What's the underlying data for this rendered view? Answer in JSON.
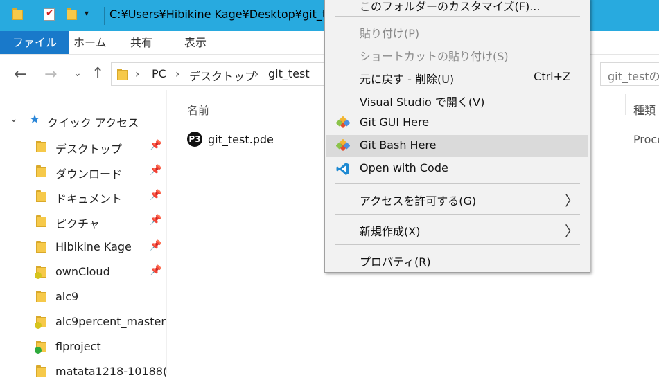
{
  "titlebar": {
    "path": "C:¥Users¥Hibikine Kage¥Desktop¥git_t",
    "dropdown": "▾"
  },
  "ribbon": {
    "tabs": [
      "ファイル",
      "ホーム",
      "共有",
      "表示"
    ]
  },
  "address": {
    "crumbs": [
      "PC",
      "デスクトップ",
      "git_test"
    ],
    "separator": "›",
    "search_placeholder": "git_testの"
  },
  "nav": {
    "back": "←",
    "forward": "→",
    "recent": "⌄",
    "up": "↑"
  },
  "sidebar": {
    "quick_access": "クイック アクセス",
    "items": [
      {
        "label": "デスクトップ",
        "pinned": true
      },
      {
        "label": "ダウンロード",
        "pinned": true
      },
      {
        "label": "ドキュメント",
        "pinned": true
      },
      {
        "label": "ピクチャ",
        "pinned": true
      },
      {
        "label": "Hibikine Kage",
        "pinned": true
      },
      {
        "label": "ownCloud",
        "pinned": true
      },
      {
        "label": "alc9",
        "pinned": false
      },
      {
        "label": "alc9percent_master",
        "pinned": false
      },
      {
        "label": "flproject",
        "pinned": false
      },
      {
        "label": "matata1218-10188(",
        "pinned": false
      }
    ],
    "pin_glyph": "📌"
  },
  "filelist": {
    "col_name": "名前",
    "col_type": "種類",
    "files": [
      {
        "name": "git_test.pde",
        "type": "Proce",
        "icon": "processing-icon"
      }
    ]
  },
  "context_menu": {
    "items": [
      {
        "label": "このフォルダーのカスタマイズ(F)...",
        "enabled": true
      },
      {
        "label": "貼り付け(P)",
        "enabled": false
      },
      {
        "label": "ショートカットの貼り付け(S)",
        "enabled": false
      },
      {
        "label": "元に戻す - 削除(U)",
        "shortcut": "Ctrl+Z",
        "enabled": true
      },
      {
        "label": "Visual Studio で開く(V)",
        "enabled": true
      },
      {
        "label": "Git GUI Here",
        "enabled": true,
        "icon": "git-icon"
      },
      {
        "label": "Git Bash Here",
        "enabled": true,
        "icon": "git-icon",
        "highlighted": true
      },
      {
        "label": "Open with Code",
        "enabled": true,
        "icon": "vscode-icon"
      },
      {
        "label": "アクセスを許可する(G)",
        "enabled": true,
        "submenu": true
      },
      {
        "label": "新規作成(X)",
        "enabled": true,
        "submenu": true
      },
      {
        "label": "プロパティ(R)",
        "enabled": true
      }
    ],
    "submenu_glyph": "〉"
  },
  "colors": {
    "titlebar": "#28aadf",
    "file_tab": "#1979ca",
    "menu_bg": "#f2f2f2",
    "menu_hover": "#dadada"
  }
}
